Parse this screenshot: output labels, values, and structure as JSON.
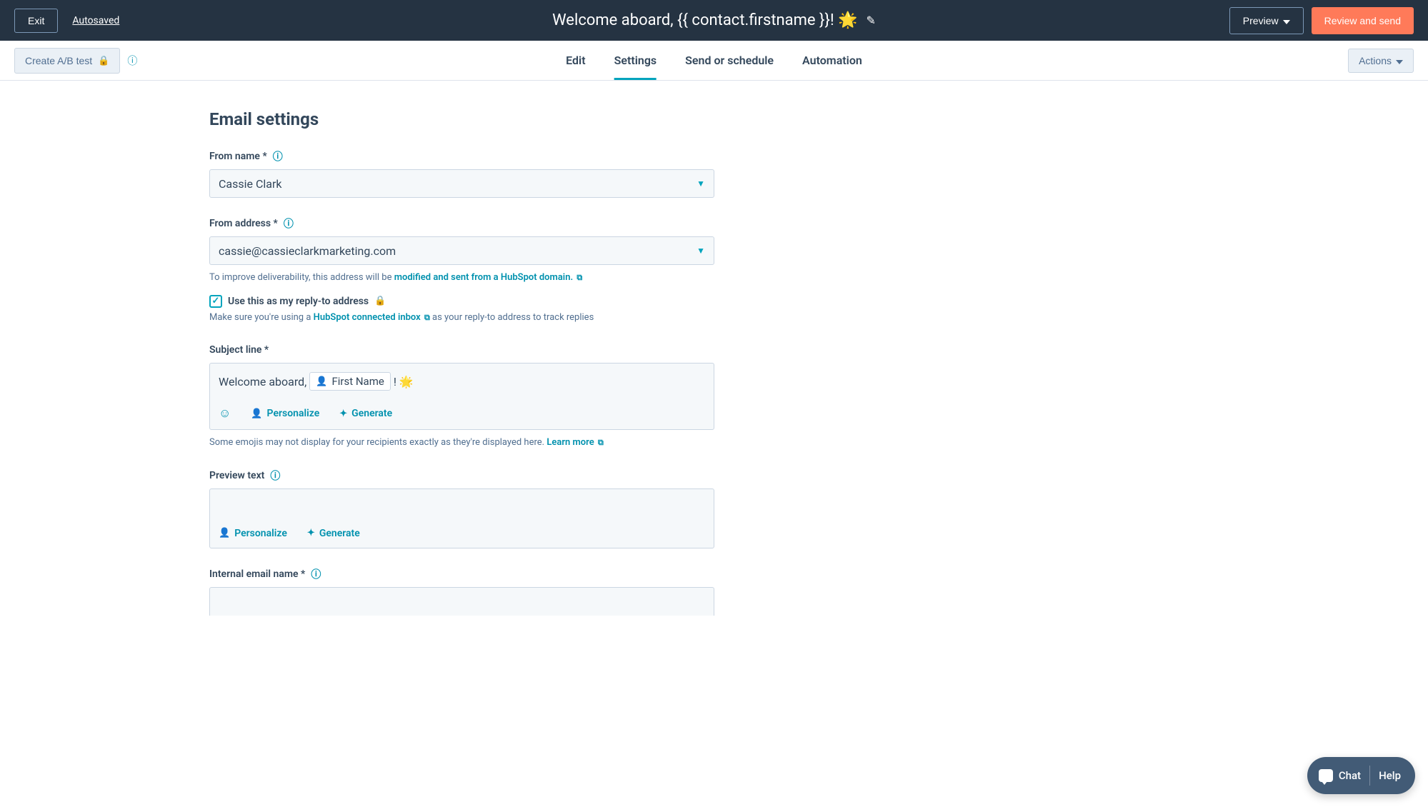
{
  "header": {
    "exit": "Exit",
    "autosaved": "Autosaved",
    "title": "Welcome aboard, {{ contact.firstname }}! 🌟",
    "preview": "Preview",
    "review": "Review and send"
  },
  "subheader": {
    "ab_test": "Create A/B test",
    "actions": "Actions",
    "tabs": {
      "edit": "Edit",
      "settings": "Settings",
      "send": "Send or schedule",
      "automation": "Automation"
    }
  },
  "page": {
    "title": "Email settings"
  },
  "from_name": {
    "label": "From name *",
    "value": "Cassie Clark"
  },
  "from_address": {
    "label": "From address *",
    "value": "cassie@cassieclarkmarketing.com",
    "helper_pre": "To improve deliverability, this address will be ",
    "helper_link": "modified and sent from a HubSpot domain."
  },
  "reply_to": {
    "checkbox_label": "Use this as my reply-to address",
    "helper_pre": "Make sure you're using a ",
    "helper_link": "HubSpot connected inbox",
    "helper_post": " as your reply-to address to track replies"
  },
  "subject": {
    "label": "Subject line *",
    "text_before": "Welcome aboard,",
    "token": "First Name",
    "text_after": "! 🌟",
    "personalize": "Personalize",
    "generate": "Generate",
    "helper_pre": "Some emojis may not display for your recipients exactly as they're displayed here. ",
    "helper_link": "Learn more"
  },
  "preview_text": {
    "label": "Preview text",
    "personalize": "Personalize",
    "generate": "Generate"
  },
  "internal_name": {
    "label": "Internal email name *"
  },
  "chat": {
    "chat": "Chat",
    "help": "Help"
  }
}
